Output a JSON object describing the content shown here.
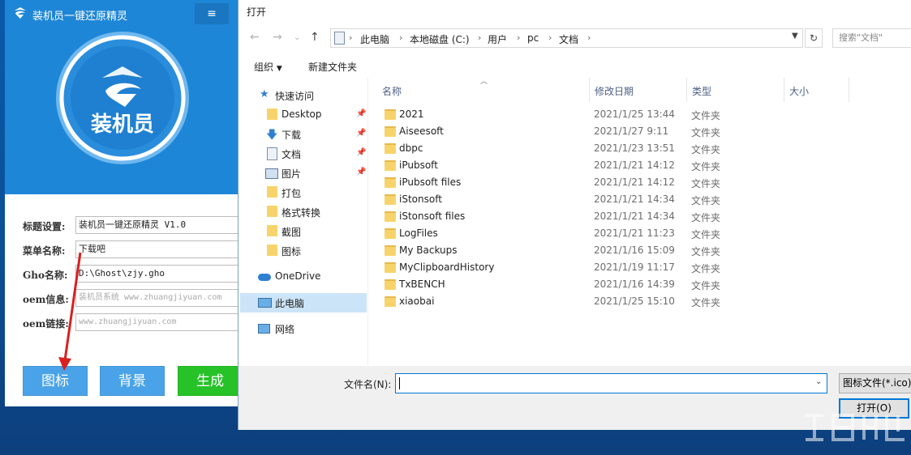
{
  "app": {
    "title": "装机员一键还原精灵",
    "emblem_text": "装机员",
    "form": [
      {
        "label": "标题设置:",
        "value": "装机员一键还原精灵 V1.0",
        "placeholder": false
      },
      {
        "label": "菜单名称:",
        "value": "下载吧",
        "placeholder": false
      },
      {
        "label": "Gho名称:",
        "value": "D:\\Ghost\\zjy.gho",
        "placeholder": false
      },
      {
        "label": "oem信息:",
        "value": "装机员系统 www.zhuangjiyuan.com",
        "placeholder": true
      },
      {
        "label": "oem链接:",
        "value": "www.zhuangjiyuan.com",
        "placeholder": true
      }
    ],
    "buttons": {
      "icon": "图标",
      "background": "背景",
      "generate": "生成"
    },
    "colors": {
      "header": "#1e86d6",
      "btn_blue": "#4aa3e8",
      "btn_green": "#27c227"
    }
  },
  "dialog": {
    "title": "打开",
    "breadcrumb": [
      "此电脑",
      "本地磁盘 (C:)",
      "用户",
      "pc",
      "文档"
    ],
    "search_placeholder": "搜索\"文档\"",
    "toolbar": {
      "organize": "组织",
      "new_folder": "新建文件夹"
    },
    "nav": {
      "quick_access": "快速访问",
      "items": [
        "Desktop",
        "下载",
        "文档",
        "图片",
        "打包",
        "格式转换",
        "截图",
        "图标"
      ],
      "onedrive": "OneDrive",
      "this_pc": "此电脑",
      "network": "网络"
    },
    "columns": {
      "name": "名称",
      "date": "修改日期",
      "type": "类型",
      "size": "大小"
    },
    "files": [
      {
        "name": "2021",
        "date": "2021/1/25 13:44",
        "type": "文件夹"
      },
      {
        "name": "Aiseesoft",
        "date": "2021/1/27 9:11",
        "type": "文件夹"
      },
      {
        "name": "dbpc",
        "date": "2021/1/23 13:51",
        "type": "文件夹"
      },
      {
        "name": "iPubsoft",
        "date": "2021/1/21 14:12",
        "type": "文件夹"
      },
      {
        "name": "iPubsoft files",
        "date": "2021/1/21 14:12",
        "type": "文件夹"
      },
      {
        "name": "iStonsoft",
        "date": "2021/1/21 14:34",
        "type": "文件夹"
      },
      {
        "name": "iStonsoft files",
        "date": "2021/1/21 14:34",
        "type": "文件夹"
      },
      {
        "name": "LogFiles",
        "date": "2021/1/21 11:23",
        "type": "文件夹"
      },
      {
        "name": "My Backups",
        "date": "2021/1/16 15:09",
        "type": "文件夹"
      },
      {
        "name": "MyClipboardHistory",
        "date": "2021/1/19 11:17",
        "type": "文件夹"
      },
      {
        "name": "TxBENCH",
        "date": "2021/1/16 14:39",
        "type": "文件夹"
      },
      {
        "name": "xiaobai",
        "date": "2021/1/25 15:10",
        "type": "文件夹"
      }
    ],
    "filename_label": "文件名(N):",
    "filename_value": "",
    "filter": "图标文件(*.ico)",
    "open_button": "打开(O)"
  }
}
